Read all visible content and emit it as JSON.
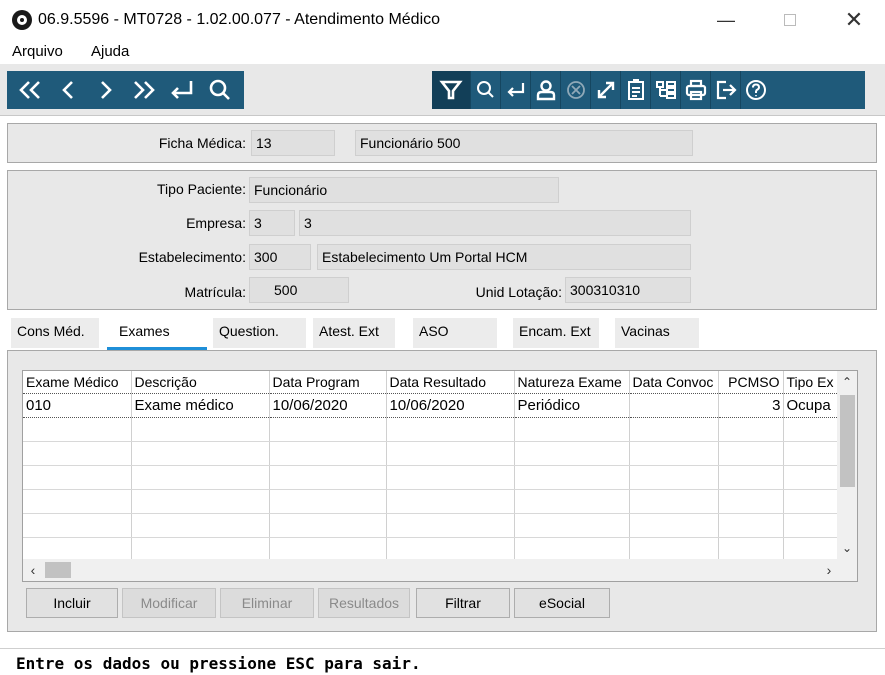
{
  "window": {
    "title": "06.9.5596 - MT0728 - 1.02.00.077 - Atendimento Médico",
    "minimize": "—",
    "close": "✕"
  },
  "menu": [
    "Arquivo",
    "Ajuda"
  ],
  "toolbar": {
    "nav": [
      "first-icon",
      "prev-icon",
      "next-icon",
      "last-icon",
      "goto-icon",
      "search-icon"
    ],
    "actions": [
      "filter-icon",
      "zoom-icon",
      "return-icon",
      "user-icon",
      "cancel-icon",
      "expand-icon",
      "clipboard-icon",
      "tree-icon",
      "print-icon",
      "exit-icon",
      "help-icon"
    ]
  },
  "header": {
    "ficha_label": "Ficha Médica:",
    "ficha_value": "13",
    "ficha_desc": "Funcionário 500"
  },
  "details": {
    "tipo_label": "Tipo Paciente:",
    "tipo_value": "Funcionário",
    "empresa_label": "Empresa:",
    "empresa_code": "3",
    "empresa_desc": "3",
    "estab_label": "Estabelecimento:",
    "estab_code": "300",
    "estab_desc": "Estabelecimento Um Portal HCM",
    "matricula_label": "Matrícula:",
    "matricula_value": "500",
    "unid_label": "Unid Lotação:",
    "unid_value": "300310310"
  },
  "tabs": [
    "Cons Méd.",
    "Exames",
    "Question.",
    "Atest. Ext",
    "ASO",
    "Encam. Ext",
    "Vacinas"
  ],
  "grid": {
    "columns": [
      "Exame Médico",
      "Descrição",
      "Data Program",
      "Data Resultado",
      "Natureza Exame",
      "Data Convoc",
      "PCMSO",
      "Tipo Ex"
    ],
    "rows": [
      [
        "010",
        "Exame médico",
        "10/06/2020",
        "10/06/2020",
        "Periódico",
        "",
        "3",
        "Ocupa"
      ]
    ]
  },
  "buttons": {
    "incluir": "Incluir",
    "modificar": "Modificar",
    "eliminar": "Eliminar",
    "resultados": "Resultados",
    "filtrar": "Filtrar",
    "esocial": "eSocial"
  },
  "status": "Entre os dados ou pressione ESC para sair."
}
